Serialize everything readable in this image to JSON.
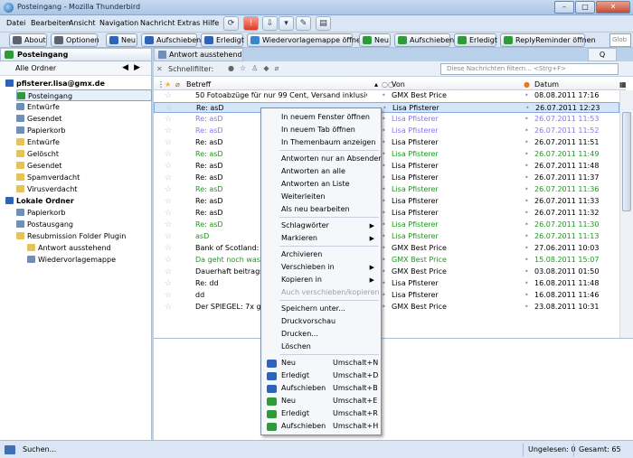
{
  "window": {
    "title": "Posteingang - Mozilla Thunderbird",
    "min": "–",
    "max": "□",
    "close": "✕"
  },
  "menu": [
    "Datei",
    "Bearbeiten",
    "Ansicht",
    "Navigation",
    "Nachricht",
    "Extras",
    "Hilfe"
  ],
  "toolbar": {
    "buttons": [
      "About",
      "Optionen",
      "Neu",
      "Aufschieben",
      "Erledigt",
      "Wiedervorlagemappe öffnen",
      "Neu",
      "Aufschieben",
      "Erledigt",
      "ReplyReminder öffnen"
    ],
    "search": "Glob"
  },
  "folder_header": {
    "title": "Posteingang",
    "all_folders": "Alle Ordner",
    "prev": "◀",
    "next": "▶"
  },
  "tab": {
    "title": "Antwort ausstehend",
    "search_tab": "Q"
  },
  "folders": [
    {
      "label": "pfisterer.lisa@gmx.de",
      "color": "#2d63b8"
    },
    {
      "label": "Posteingang",
      "color": "#2e9a38"
    },
    {
      "label": "Entwürfe",
      "color": "#6f8fb8"
    },
    {
      "label": "Gesendet",
      "color": "#6f8fb8"
    },
    {
      "label": "Papierkorb",
      "color": "#6f8fb8"
    },
    {
      "label": "Entwürfe",
      "color": "#e6c25a"
    },
    {
      "label": "Gelöscht",
      "color": "#e6c25a"
    },
    {
      "label": "Gesendet",
      "color": "#e6c25a"
    },
    {
      "label": "Spamverdacht",
      "color": "#e6c25a"
    },
    {
      "label": "Virusverdacht",
      "color": "#e6c25a"
    },
    {
      "label": "Lokale Ordner",
      "color": "#2d63b8"
    },
    {
      "label": "Papierkorb",
      "color": "#6f8fb8"
    },
    {
      "label": "Postausgang",
      "color": "#6f8fb8"
    },
    {
      "label": "Resubmission Folder Plugin",
      "color": "#e6c25a"
    },
    {
      "label": "Antwort ausstehend",
      "color": "#e6c25a"
    },
    {
      "label": "Wiedervorlagemappe",
      "color": "#6f8fb8"
    }
  ],
  "filter": {
    "label": "Schnellfilter:",
    "placeholder": "Diese Nachrichten filtern... <Strg+F>"
  },
  "columns": {
    "subject": "Betreff",
    "from": "Von",
    "date": "Datum"
  },
  "messages": [
    {
      "subject": "50 Fotoabzüge für nur 99 Cent, Versand inklusive! Jetzt mit ...",
      "from": "GMX Best Price",
      "date": "08.08.2011 17:16",
      "style": ""
    },
    {
      "subject": "Re: asD",
      "from": "Lisa Pfisterer",
      "date": "26.07.2011 12:23",
      "style": "sel"
    },
    {
      "subject": "Re: asD",
      "from": "Lisa Pfisterer",
      "date": "26.07.2011 11:53",
      "style": "purple"
    },
    {
      "subject": "Re: asD",
      "from": "Lisa Pfisterer",
      "date": "26.07.2011 11:52",
      "style": "purple"
    },
    {
      "subject": "Re: asD",
      "from": "Lisa Pfisterer",
      "date": "26.07.2011 11:51",
      "style": ""
    },
    {
      "subject": "Re: asD",
      "from": "Lisa Pfisterer",
      "date": "26.07.2011 11:49",
      "style": "green"
    },
    {
      "subject": "Re: asD",
      "from": "Lisa Pfisterer",
      "date": "26.07.2011 11:48",
      "style": ""
    },
    {
      "subject": "Re: asD",
      "from": "Lisa Pfisterer",
      "date": "26.07.2011 11:37",
      "style": ""
    },
    {
      "subject": "Re: asD",
      "from": "Lisa Pfisterer",
      "date": "26.07.2011 11:36",
      "style": "green"
    },
    {
      "subject": "Re: asD",
      "from": "Lisa Pfisterer",
      "date": "26.07.2011 11:33",
      "style": ""
    },
    {
      "subject": "Re: asD",
      "from": "Lisa Pfisterer",
      "date": "26.07.2011 11:32",
      "style": ""
    },
    {
      "subject": "Re: asD",
      "from": "Lisa Pfisterer",
      "date": "26.07.2011 11:30",
      "style": "green"
    },
    {
      "subject": "asD",
      "from": "Lisa Pfisterer",
      "date": "26.07.2011 11:13",
      "style": "green"
    },
    {
      "subject": "Bank of Scotland: 2,4%",
      "from": "GMX Best Price",
      "date": "27.06.2011 10:03",
      "style": ""
    },
    {
      "subject": "Da geht noch was: Zin",
      "from": "GMX Best Price",
      "date": "15.08.2011 15:07",
      "style": "green"
    },
    {
      "subject": "Dauerhaft beitragsfrei",
      "from": "GMX Best Price",
      "date": "03.08.2011 01:50",
      "style": ""
    },
    {
      "subject": "Re: dd",
      "from": "Lisa Pfisterer",
      "date": "16.08.2011 11:48",
      "style": ""
    },
    {
      "subject": "dd",
      "from": "Lisa Pfisterer",
      "date": "16.08.2011 11:46",
      "style": ""
    },
    {
      "subject": "Der SPIEGEL: 7x gut in",
      "from": "GMX Best Price",
      "date": "23.08.2011 10:31",
      "style": ""
    }
  ],
  "context_menu": [
    {
      "label": "In neuem Fenster öffnen"
    },
    {
      "label": "In neuem Tab öffnen"
    },
    {
      "label": "In Themenbaum anzeigen"
    },
    {
      "label": "Antworten nur an Absender"
    },
    {
      "label": "Antworten an alle"
    },
    {
      "label": "Antworten an Liste"
    },
    {
      "label": "Weiterleiten"
    },
    {
      "label": "Als neu bearbeiten"
    },
    {
      "label": "Schlagwörter",
      "submenu": "▶"
    },
    {
      "label": "Markieren",
      "submenu": "▶"
    },
    {
      "label": "Archivieren"
    },
    {
      "label": "Verschieben in",
      "submenu": "▶"
    },
    {
      "label": "Kopieren in",
      "submenu": "▶"
    },
    {
      "label": "Auch verschieben/kopieren",
      "disabled": true
    },
    {
      "label": "Speichern unter..."
    },
    {
      "label": "Druckvorschau"
    },
    {
      "label": "Drucken..."
    },
    {
      "label": "Löschen"
    },
    {
      "label": "Neu",
      "shortcut": "Umschalt+N",
      "color": "#2d63b8"
    },
    {
      "label": "Erledigt",
      "shortcut": "Umschalt+D",
      "color": "#2d63b8"
    },
    {
      "label": "Aufschieben",
      "shortcut": "Umschalt+B",
      "color": "#2d63b8"
    },
    {
      "label": "Neu",
      "shortcut": "Umschalt+E",
      "color": "#2e9a38"
    },
    {
      "label": "Erledigt",
      "shortcut": "Umschalt+R",
      "color": "#2e9a38"
    },
    {
      "label": "Aufschieben",
      "shortcut": "Umschalt+H",
      "color": "#2e9a38"
    }
  ],
  "status": {
    "text": "Suchen...",
    "unread": "Ungelesen: 0",
    "total": "Gesamt: 65"
  }
}
